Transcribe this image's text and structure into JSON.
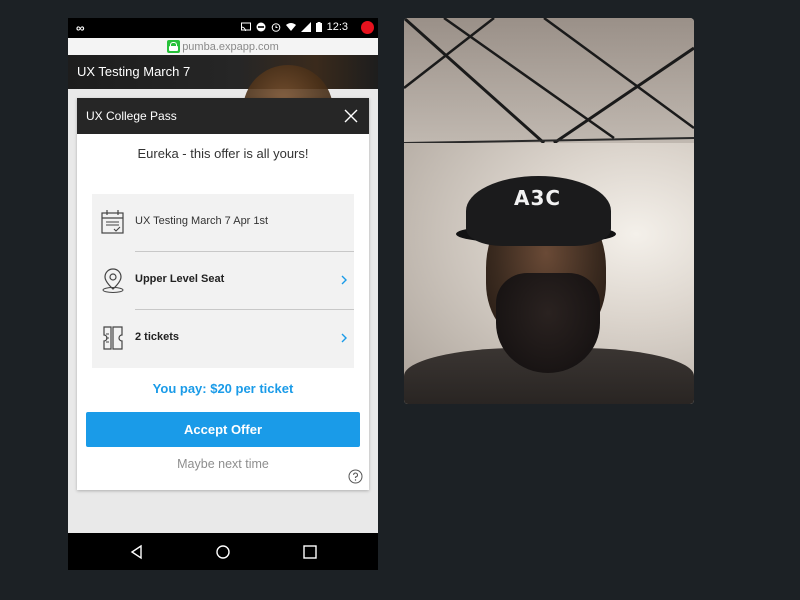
{
  "status_bar": {
    "carrier_glyph": "∞",
    "time": "12:3",
    "icons": [
      "cast-icon",
      "do-not-disturb-icon",
      "alarm-icon",
      "wifi-icon",
      "signal-icon",
      "battery-icon"
    ],
    "record_color": "#e8121e"
  },
  "browser": {
    "url": "pumba.expapp.com",
    "secure": true
  },
  "page": {
    "header_title": "UX Testing March 7"
  },
  "modal": {
    "title": "UX College Pass",
    "heading": "Eureka - this offer is all yours!",
    "options": [
      {
        "icon": "calendar-icon",
        "label": "UX Testing March 7 Apr 1st",
        "has_chevron": false
      },
      {
        "icon": "location-pin-icon",
        "label": "Upper Level Seat",
        "has_chevron": true
      },
      {
        "icon": "ticket-icon",
        "label": "2 tickets",
        "has_chevron": true
      }
    ],
    "pay_text": "You pay: $20 per ticket",
    "accept_label": "Accept Offer",
    "decline_label": "Maybe next time",
    "accent_color": "#1a9be8"
  },
  "nav": {
    "buttons": [
      "back-icon",
      "home-icon",
      "recents-icon"
    ]
  },
  "video": {
    "cap_text": "A3C"
  }
}
